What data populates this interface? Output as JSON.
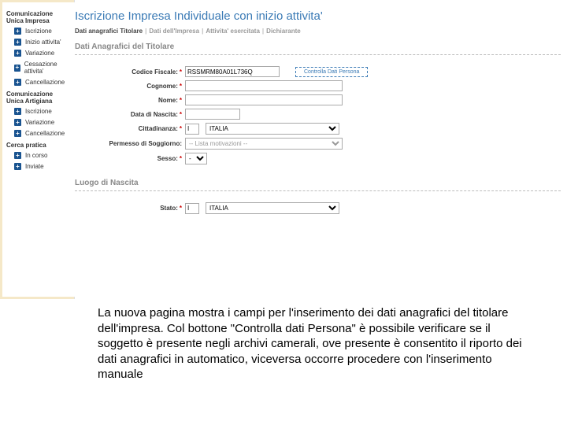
{
  "sidebar": {
    "groups": [
      {
        "heading": "Comunicazione Unica Impresa",
        "items": [
          "Iscrizione",
          "Inizio attivita'",
          "Variazione",
          "Cessazione attivita'",
          "Cancellazione"
        ]
      },
      {
        "heading": "Comunicazione Unica Artigiana",
        "items": [
          "Iscrizione",
          "Variazione",
          "Cancellazione"
        ]
      },
      {
        "heading": "Cerca pratica",
        "items": [
          "In corso",
          "Inviate"
        ]
      }
    ]
  },
  "page": {
    "title": "Iscrizione Impresa Individuale con inizio attivita'",
    "tabs": [
      "Dati anagrafici Titolare",
      "Dati dell'Impresa",
      "Attivita' esercitata",
      "Dichiarante"
    ]
  },
  "section1": {
    "title": "Dati Anagrafici del Titolare"
  },
  "form": {
    "codice_fiscale_label": "Codice Fiscale:",
    "codice_fiscale_value": "RSSMRM80A01L736Q",
    "controlla_btn": "Controlla Dati Persona",
    "cognome_label": "Cognome:",
    "nome_label": "Nome:",
    "data_nascita_label": "Data di Nascita:",
    "cittadinanza_label": "Cittadinanza:",
    "cittadinanza_value": "I",
    "cittadinanza_text": "ITALIA",
    "permesso_label": "Permesso di Soggiorno:",
    "permesso_value": "-- Lista motivazioni --",
    "sesso_label": "Sesso:",
    "sesso_value": "-"
  },
  "section2": {
    "title": "Luogo di Nascita"
  },
  "form2": {
    "stato_label": "Stato:",
    "stato_value": "I",
    "stato_text": "ITALIA"
  },
  "caption": "La nuova pagina mostra i campi per l'inserimento dei dati anagrafici del titolare dell'impresa. Col bottone \"Controlla dati Persona\" è possibile verificare se il soggetto è presente negli archivi camerali, ove presente è consentito il riporto dei dati anagrafici in automatico, viceversa occorre procedere con l'inserimento manuale"
}
